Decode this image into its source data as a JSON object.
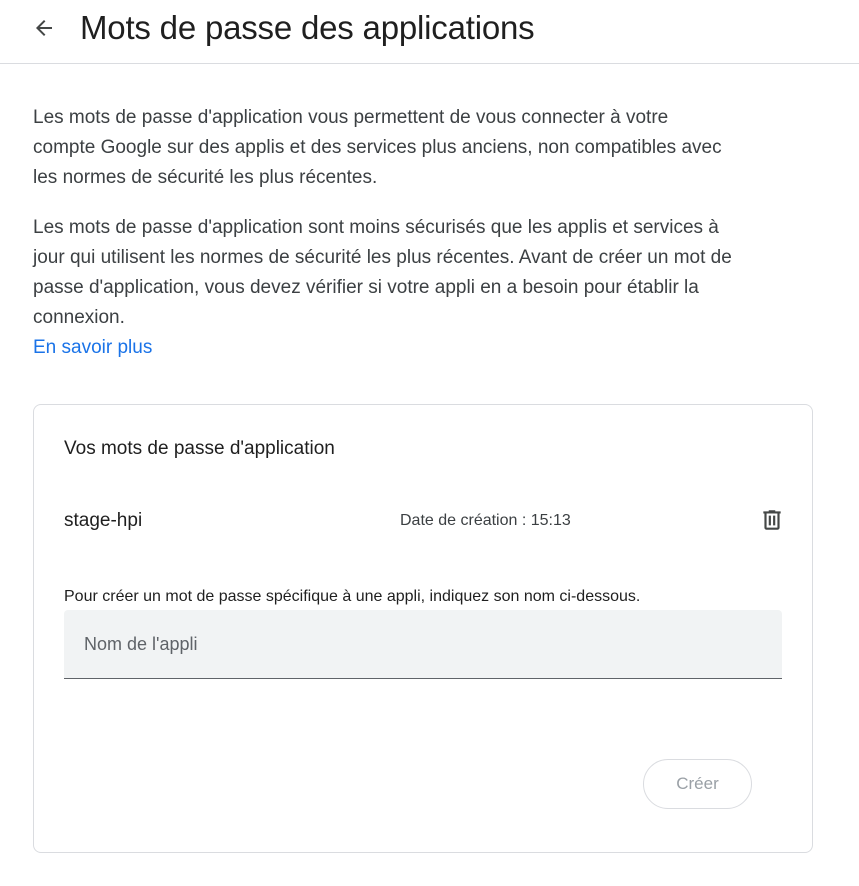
{
  "header": {
    "back_icon": "arrow-back-icon",
    "title": "Mots de passe des applications"
  },
  "intro": {
    "paragraph_1": "Les mots de passe d'application vous permettent de vous connecter à votre compte Google sur des applis et des services plus anciens, non compatibles avec les normes de sécurité les plus récentes.",
    "paragraph_2": "Les mots de passe d'application sont moins sécurisés que les applis et services à jour qui utilisent les normes de sécurité les plus récentes. Avant de créer un mot de passe d'application, vous devez vérifier si votre appli en a besoin pour établir la connexion.",
    "learn_more": "En savoir plus"
  },
  "card": {
    "title": "Vos mots de passe d'application",
    "passwords": [
      {
        "name": "stage-hpi",
        "created": "Date de création : 15:13",
        "delete_icon": "trash-icon"
      }
    ],
    "hint": "Pour créer un mot de passe spécifique à une appli, indiquez son nom ci-dessous.",
    "input": {
      "placeholder": "Nom de l'appli",
      "value": ""
    },
    "create_label": "Créer",
    "create_disabled": true
  },
  "colors": {
    "accent_link": "#1a73e8",
    "text_primary": "#1f1f1f",
    "text_secondary": "#3c4043",
    "input_bg": "#f1f3f4",
    "border": "#dadce0",
    "disabled_text": "#9aa0a6"
  }
}
